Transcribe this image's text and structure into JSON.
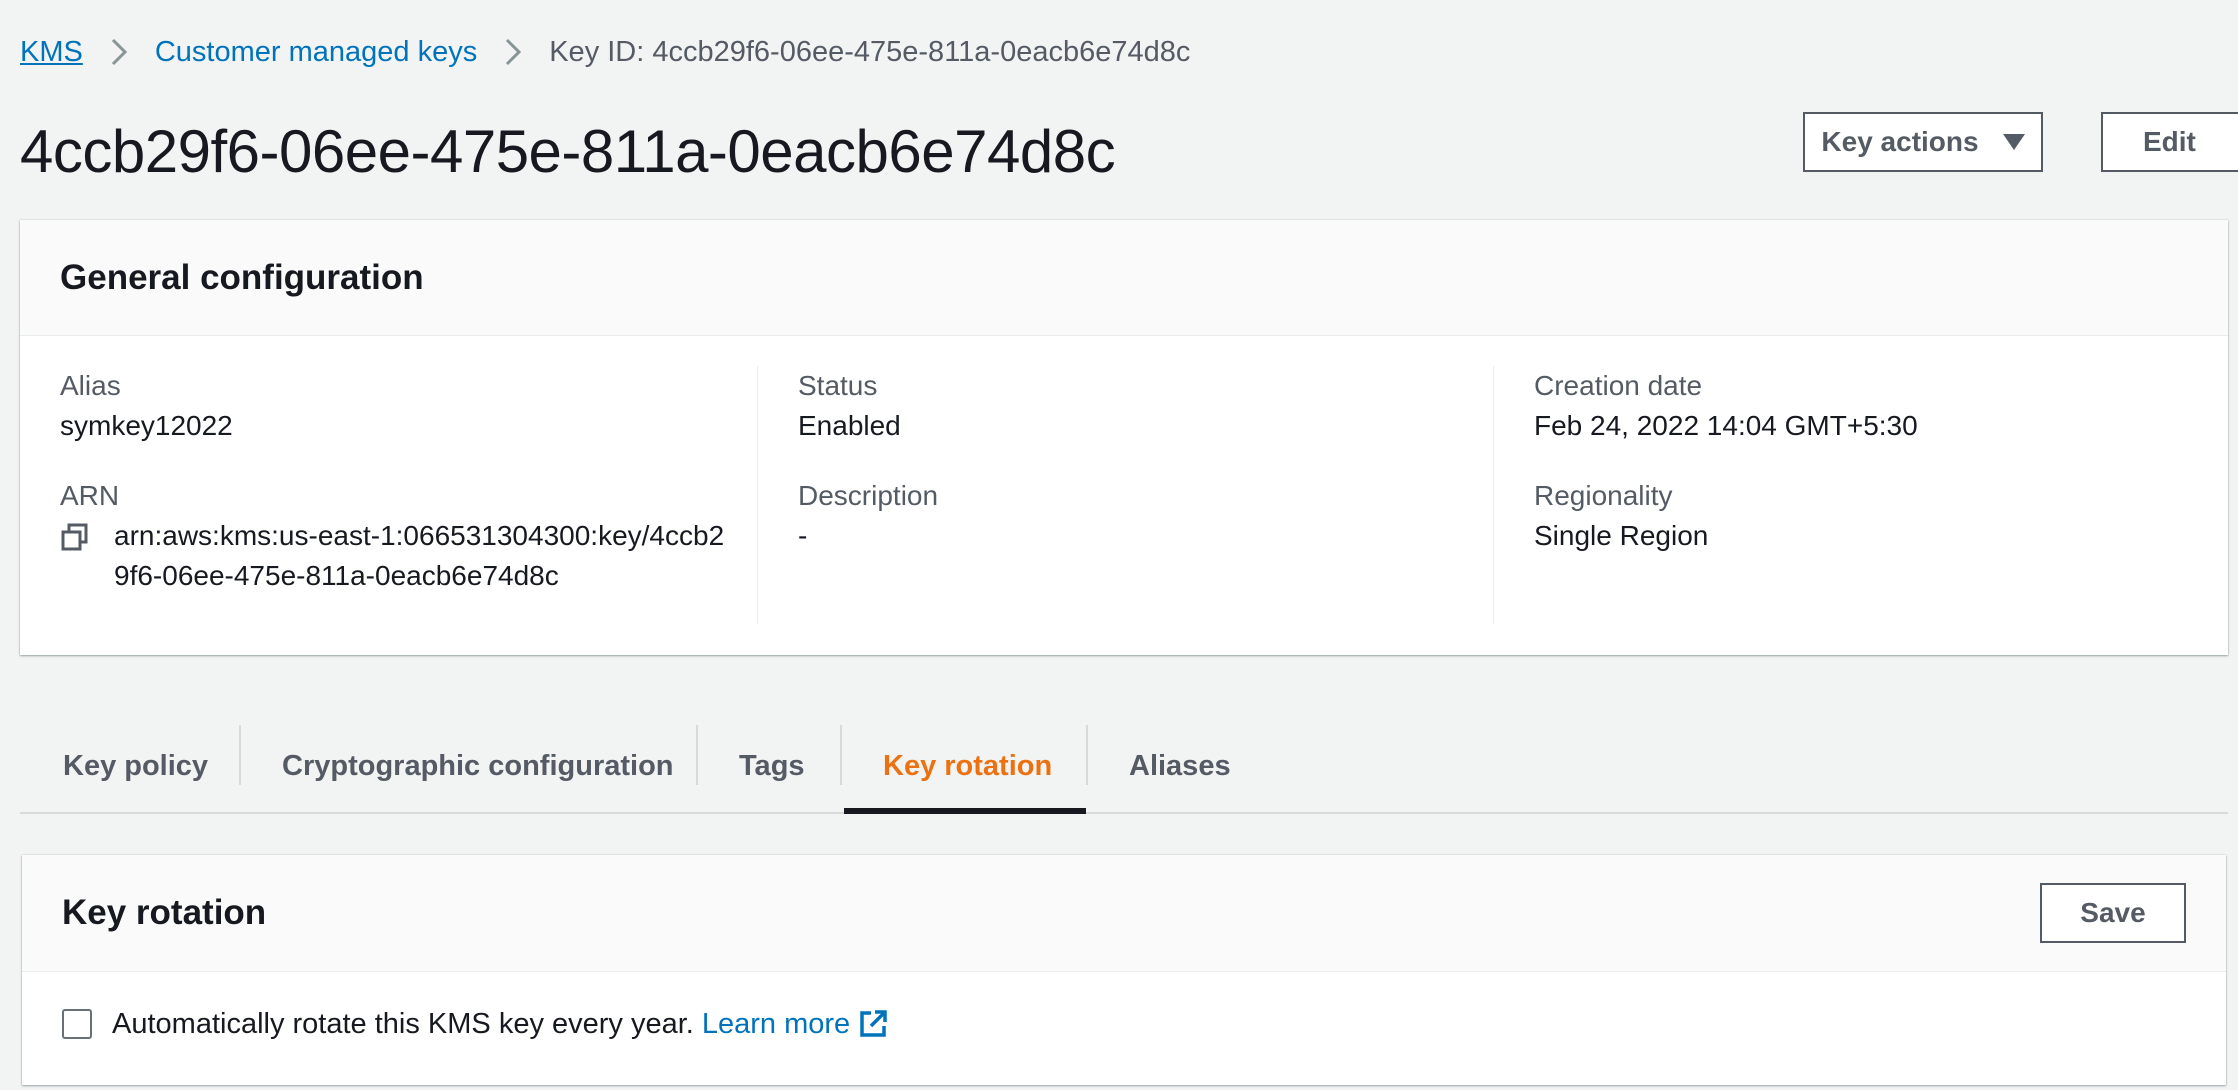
{
  "breadcrumb": {
    "kms": "KMS",
    "customer_managed_keys": "Customer managed keys",
    "current": "Key ID: 4ccb29f6-06ee-475e-811a-0eacb6e74d8c"
  },
  "page": {
    "title": "4ccb29f6-06ee-475e-811a-0eacb6e74d8c"
  },
  "header_actions": {
    "key_actions_label": "Key actions",
    "edit_label": "Edit"
  },
  "general_config": {
    "title": "General configuration",
    "alias_label": "Alias",
    "alias_value": "symkey12022",
    "arn_label": "ARN",
    "arn_value": "arn:aws:kms:us-east-1:066531304300:key/4ccb29f6-06ee-475e-811a-0eacb6e74d8c",
    "status_label": "Status",
    "status_value": "Enabled",
    "description_label": "Description",
    "description_value": "-",
    "creation_date_label": "Creation date",
    "creation_date_value": "Feb 24, 2022 14:04 GMT+5:30",
    "regionality_label": "Regionality",
    "regionality_value": "Single Region"
  },
  "tabs": [
    {
      "label": "Key policy"
    },
    {
      "label": "Cryptographic configuration"
    },
    {
      "label": "Tags"
    },
    {
      "label": "Key rotation",
      "active": true
    },
    {
      "label": "Aliases"
    }
  ],
  "key_rotation": {
    "title": "Key rotation",
    "save_label": "Save",
    "checkbox_label": "Automatically rotate this KMS key every year.",
    "checked": false,
    "learn_more": "Learn more"
  },
  "colors": {
    "link": "#0073bb",
    "active_tab": "#ec7211",
    "text": "#16191f",
    "muted": "#545b64",
    "background": "#f2f3f3"
  },
  "icons": {
    "breadcrumb_separator": "chevron-right-icon",
    "dropdown": "caret-down-icon",
    "copy": "copy-icon",
    "external_link": "external-link-icon"
  }
}
